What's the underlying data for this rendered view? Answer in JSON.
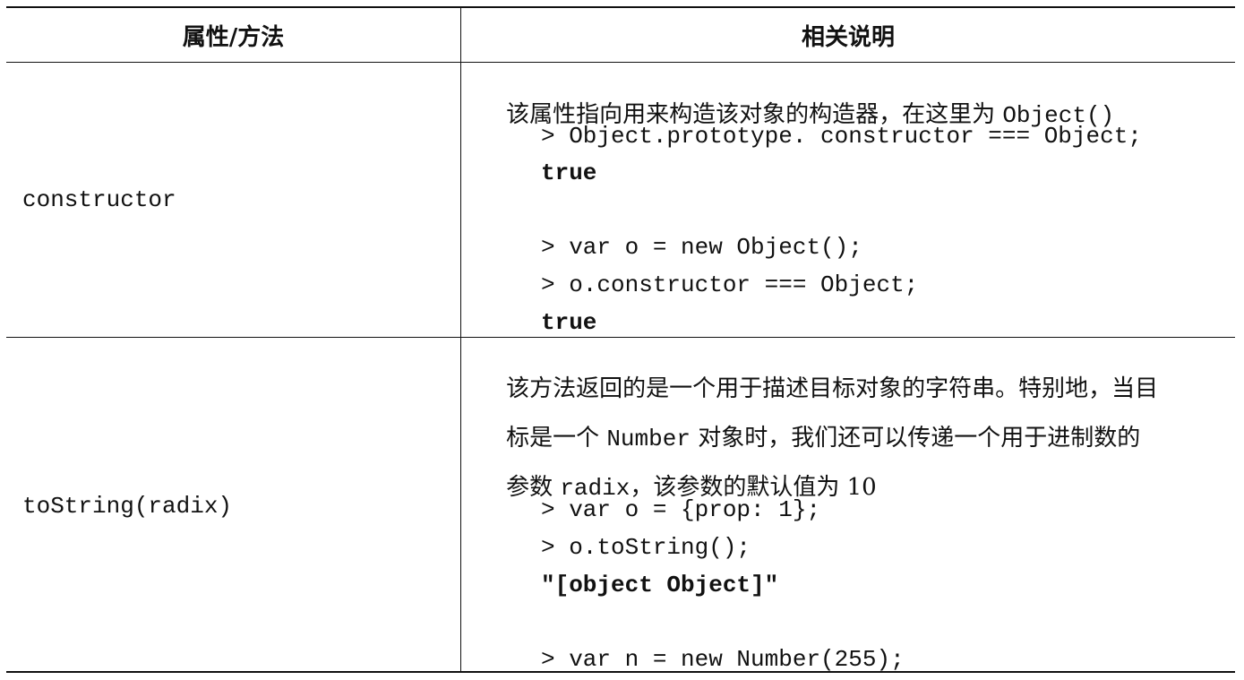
{
  "header": {
    "col1": "属性/方法",
    "col2": "相关说明"
  },
  "rows": [
    {
      "name": "constructor",
      "desc_lines": [
        [
          {
            "t": "该属性指向用来构造该对象的构造器，在这里为 ",
            "mono": false
          },
          {
            "t": "Object()",
            "mono": true
          }
        ]
      ],
      "code_lines": [
        "> Object.prototype. constructor === Object;",
        "true",
        "",
        "> var o = new Object();",
        "> o.constructor === Object;",
        "true"
      ]
    },
    {
      "name": "toString(radix)",
      "desc_lines": [
        [
          {
            "t": "该方法返回的是一个用于描述目标对象的字符串。特别地，当目",
            "mono": false
          }
        ],
        [
          {
            "t": "标是一个 ",
            "mono": false
          },
          {
            "t": "Number",
            "mono": true
          },
          {
            "t": " 对象时，我们还可以传递一个用于进制数的",
            "mono": false
          }
        ],
        [
          {
            "t": "参数 ",
            "mono": false
          },
          {
            "t": "radix",
            "mono": true
          },
          {
            "t": "，该参数的默认值为 10",
            "mono": false
          }
        ]
      ],
      "code_lines": [
        "> var o = {prop: 1};",
        "> o.toString();",
        "\"[object Object]\"",
        "",
        "> var n = new Number(255);"
      ]
    }
  ]
}
